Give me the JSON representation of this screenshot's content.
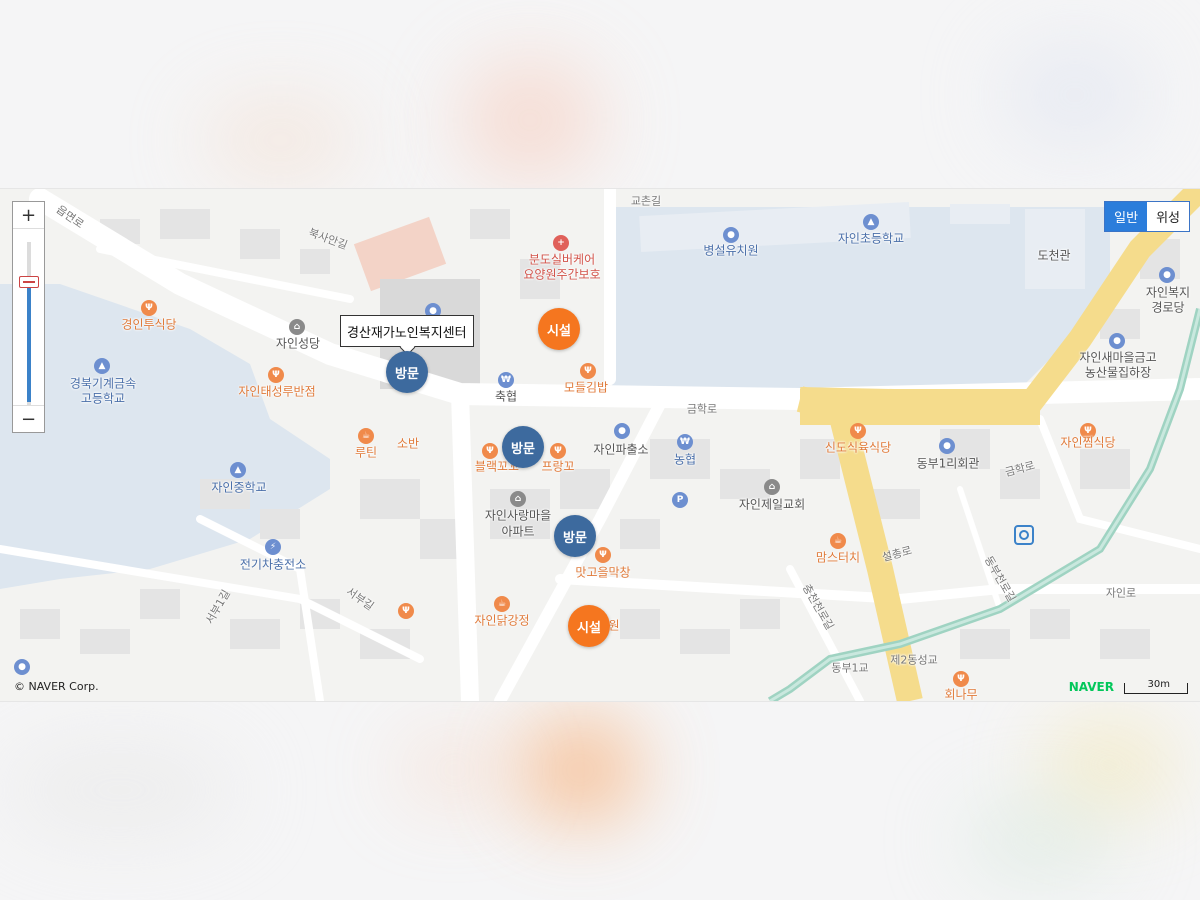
{
  "map": {
    "tooltip": "경산재가노인복지센터",
    "markers": [
      {
        "label": "방문",
        "kind": "visit"
      },
      {
        "label": "방문",
        "kind": "visit"
      },
      {
        "label": "방문",
        "kind": "visit"
      },
      {
        "label": "시설",
        "kind": "facility"
      },
      {
        "label": "시설",
        "kind": "facility"
      }
    ],
    "map_type": {
      "normal": "일반",
      "satellite": "위성",
      "selected": "일반"
    },
    "zoom": {
      "in": "+",
      "out": "−"
    },
    "copyright": "© NAVER Corp.",
    "brand": "NAVER",
    "scale": "30m",
    "places": {
      "byeongseol": "병설유치원",
      "jain_elem": "자인초등학교",
      "docheon": "도천관",
      "bundo_1": "분도실버케어",
      "bundo_2": "요양원주간보호",
      "jain_welfare_1": "자인복지",
      "jain_welfare_2": "경로당",
      "gyeongin": "경인투식당",
      "jain_church": "자인성당",
      "modeul": "모들김밥",
      "saemaul_1": "자인새마을금고",
      "saemaul_2": "농산물집하장",
      "gyeongbuk_1": "경북기계금속",
      "gyeongbuk_2": "고등학교",
      "taeseong": "자인태성루반점",
      "chukhyeop": "축협",
      "geumhak": "금학로",
      "soban": "소반",
      "rutin": "루틴",
      "police": "자인파출소",
      "nonghyup": "농협",
      "sindo": "신도식육식당",
      "dongbu": "동부1리회관",
      "jjim": "자인찜식당",
      "block": "블랙꼬꼬",
      "frang": "프랑꼬",
      "jain_middle": "자인중학교",
      "apartment_1": "자인사랑마을",
      "apartment_2": "아파트",
      "jeil_church": "자인제일교회",
      "moms": "맘스터치",
      "ev": "전기차충전소",
      "matgoeul": "맛고을막창",
      "dakgang": "자인닭강정",
      "gyochon": "교촌길",
      "buksa": "북사안길",
      "road_west": "읍면로",
      "geumhak2": "금학로",
      "seolchong": "설총로",
      "jainro": "자인로",
      "dongbu1": "동부1교",
      "dongseong2": "제2동성교",
      "dongbu_gil": "동부천로길",
      "seobu1": "서부1길",
      "seobu_gil": "서부길",
      "chungcheon": "충천천로길",
      "hoe": "회나무",
      "hospital_partial": "원"
    },
    "colors": {
      "visit": "#3d6a9e",
      "facility": "#f5761f",
      "water": "#dce6f0",
      "major_road": "#f6dc8a",
      "river": "#9fd3c2",
      "accent": "#2b7ddb"
    }
  }
}
